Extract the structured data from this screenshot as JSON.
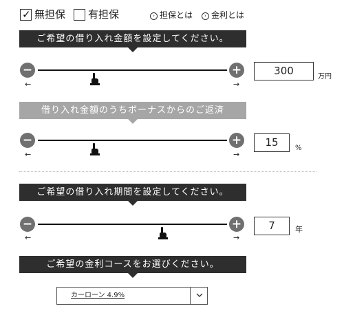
{
  "collateral": {
    "without": {
      "label": "無担保",
      "checked": true,
      "mark": "✓"
    },
    "with": {
      "label": "有担保",
      "checked": false
    },
    "links": [
      {
        "icon": "circle-chevron-icon",
        "glyph": "›",
        "label": "担保とは"
      },
      {
        "icon": "circle-chevron-icon",
        "glyph": "›",
        "label": "金利とは"
      }
    ]
  },
  "sections": {
    "amount": {
      "title": "ご希望の借り入れ金額を設定してください。",
      "value": "300",
      "unit": "万円",
      "slider_fraction": 0.3
    },
    "bonus": {
      "title": "借り入れ金額のうちボーナスからのご返済",
      "value": "15",
      "unit": "%",
      "slider_fraction": 0.3
    },
    "period": {
      "title": "ご希望の借り入れ期間を設定してください。",
      "value": "7",
      "unit": "年",
      "slider_fraction": 0.66
    },
    "rate": {
      "title": "ご希望の金利コースをお選びください。",
      "selected": "カーローン 4.9%"
    }
  },
  "controls": {
    "minus": "−",
    "plus": "+",
    "arrow_left": "←",
    "arrow_right": "→",
    "chevron": "chevron-down-icon"
  },
  "colors": {
    "banner_dark": "#2e2e2e",
    "banner_light": "#a6a6a6",
    "button": "#707070"
  }
}
